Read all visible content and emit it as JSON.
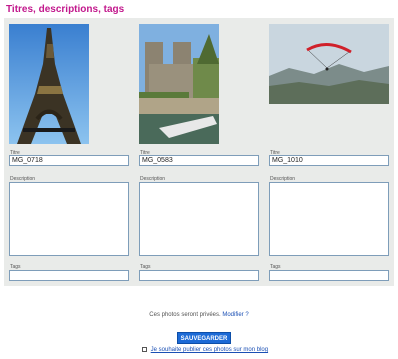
{
  "heading": "Titres, descriptions, tags",
  "photos": [
    {
      "title_label": "Titre",
      "title_value": "MG_0718",
      "description_label": "Description",
      "description_value": "",
      "tags_label": "Tags",
      "tags_value": ""
    },
    {
      "title_label": "Titre",
      "title_value": "MG_0583",
      "description_label": "Description",
      "description_value": "",
      "tags_label": "Tags",
      "tags_value": ""
    },
    {
      "title_label": "Titre",
      "title_value": "MG_1010",
      "description_label": "Description",
      "description_value": "",
      "tags_label": "Tags",
      "tags_value": ""
    }
  ],
  "footer": {
    "note_prefix": "Ces photos seront privées.",
    "note_link": "Modifier ?",
    "save_button": "SAUVEGARDER",
    "checkbox_text": "Je souhaite publier ces photos sur mon blog"
  },
  "colors": {
    "heading": "#c2188c",
    "panel": "#e9ebe9",
    "button": "#1c6ad6",
    "input_border": "#7e9db9"
  }
}
